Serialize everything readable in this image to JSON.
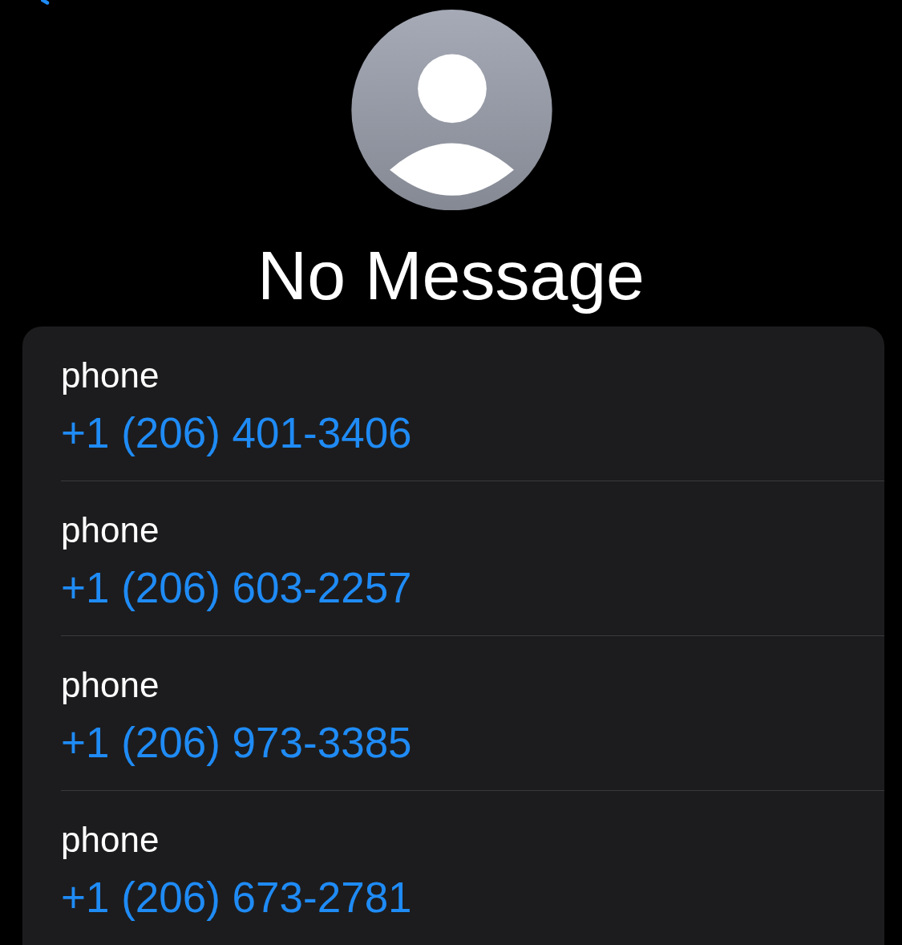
{
  "contact": {
    "name": "No Message"
  },
  "phone_numbers": [
    {
      "label": "phone",
      "number": "+1 (206) 401-3406"
    },
    {
      "label": "phone",
      "number": "+1 (206) 603-2257"
    },
    {
      "label": "phone",
      "number": "+1 (206) 973-3385"
    },
    {
      "label": "phone",
      "number": "+1 (206) 673-2781"
    }
  ]
}
